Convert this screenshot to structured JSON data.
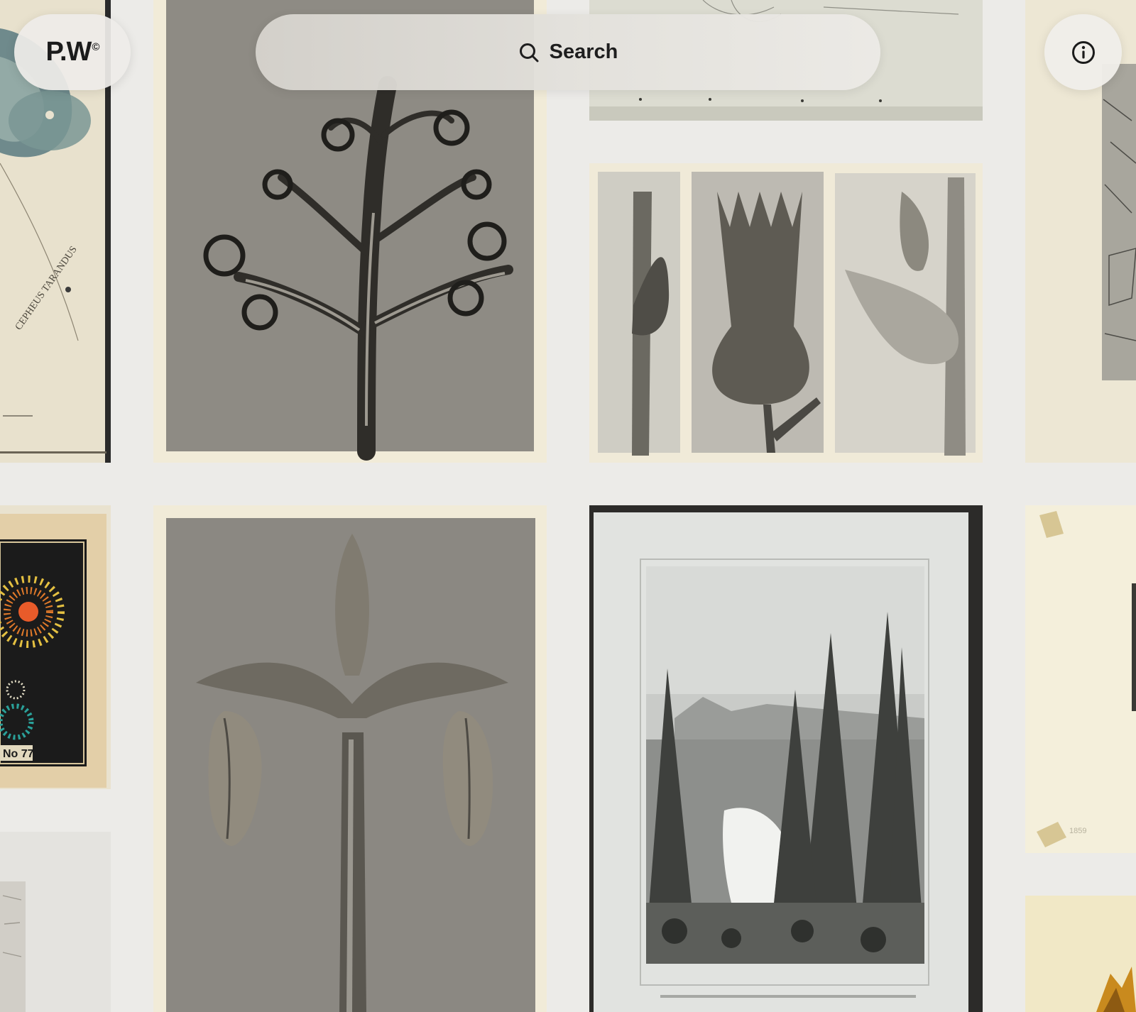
{
  "header": {
    "logo_text": "P.W",
    "logo_mark": "©",
    "search_label": "Search",
    "search_icon": "magnifier",
    "info_icon": "info-circle"
  },
  "tiles": [
    {
      "name": "constellation-map-print",
      "caption": "CEPHEUS  TARANDUS"
    },
    {
      "name": "unfurling-plant-photogravure"
    },
    {
      "name": "botanical-sketch-print"
    },
    {
      "name": "triptych-plant-photogravure"
    },
    {
      "name": "landscape-sketch-print"
    },
    {
      "name": "fireworks-chromolithograph",
      "caption": "No 77"
    },
    {
      "name": "bud-stem-photogravure"
    },
    {
      "name": "waterfall-forest-lithograph"
    },
    {
      "name": "taped-etching-print",
      "caption": "1859"
    },
    {
      "name": "pale-manuscript-print"
    },
    {
      "name": "golden-illustration-print"
    }
  ],
  "colors": {
    "page_background": "#ecebe8",
    "control_background": "#eeece8",
    "text": "#1b1b1b"
  }
}
